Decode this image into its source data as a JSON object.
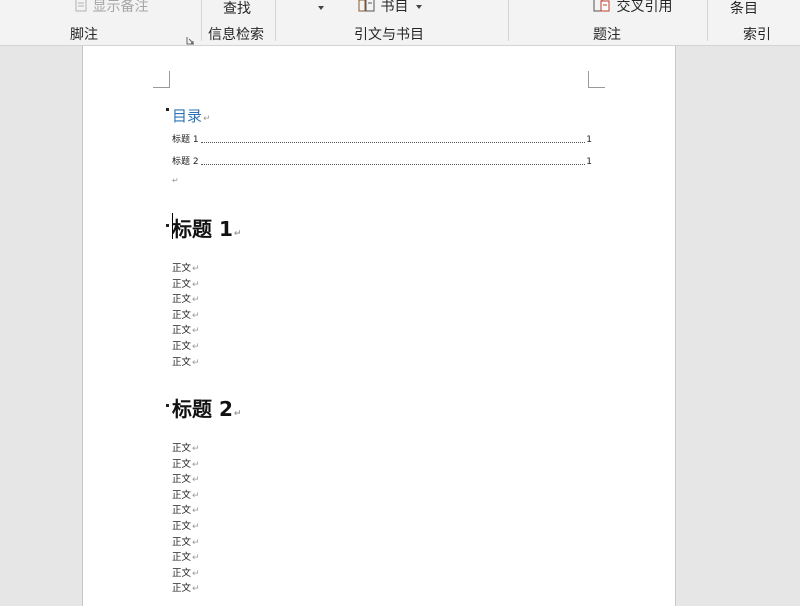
{
  "ribbon": {
    "show_notes": "显示备注",
    "footnote_group": "脚注",
    "search_label": "查找",
    "research_group": "信息检索",
    "bibliography": "书目",
    "citations_group": "引文与书目",
    "cross_reference": "交叉引用",
    "captions_group": "题注",
    "mark_entry": "条目",
    "index_group": "索引"
  },
  "document": {
    "toc_title": "目录",
    "toc_entries": [
      {
        "label": "标题 1",
        "page": "1"
      },
      {
        "label": "标题 2",
        "page": "1"
      }
    ],
    "headings": [
      {
        "text": "标题 1"
      },
      {
        "text": "标题 2"
      }
    ],
    "section1_body": [
      "正文",
      "正文",
      "正文",
      "正文",
      "正文",
      "正文",
      "正文"
    ],
    "section2_body": [
      "正文",
      "正文",
      "正文",
      "正文",
      "正文",
      "正文",
      "正文",
      "正文",
      "正文",
      "正文"
    ]
  }
}
